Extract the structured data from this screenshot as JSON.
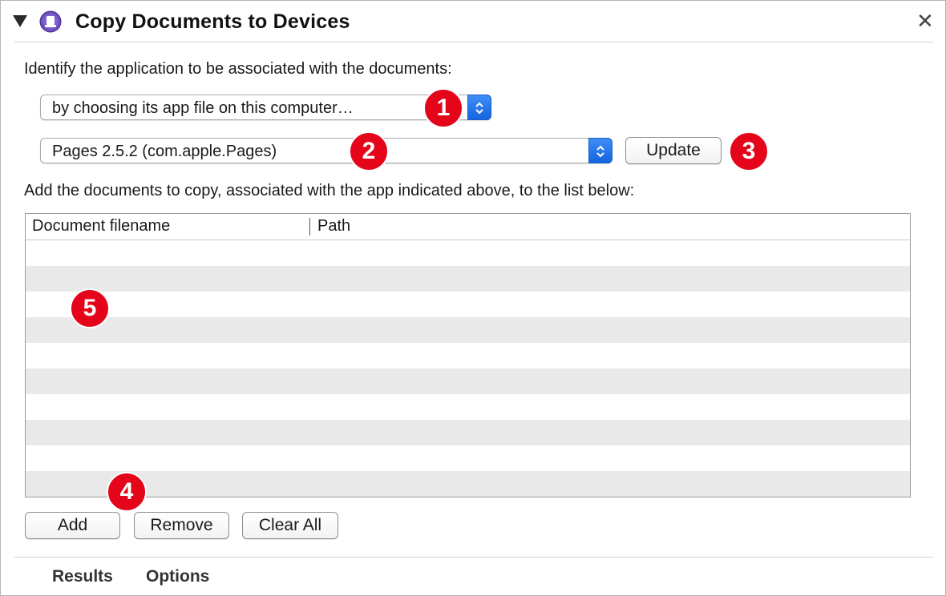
{
  "header": {
    "title": "Copy Documents to Devices",
    "action_icon": "automator-device-icon",
    "close_label": "✕"
  },
  "app_section": {
    "prompt": "Identify the application to be associated with the documents:",
    "method_popup": {
      "selected": "by choosing its app file on this computer…"
    },
    "app_popup": {
      "selected": "Pages 2.5.2 (com.apple.Pages)"
    },
    "update_button": "Update"
  },
  "documents_section": {
    "prompt": "Add the documents to copy, associated with the app indicated above, to the list below:",
    "columns": [
      "Document filename",
      "Path"
    ],
    "rows": []
  },
  "buttons": {
    "add": "Add",
    "remove": "Remove",
    "clear_all": "Clear All"
  },
  "callouts": {
    "c1": "1",
    "c2": "2",
    "c3": "3",
    "c4": "4",
    "c5": "5",
    "color": "#e4051b"
  },
  "footer_tabs": [
    "Results",
    "Options"
  ]
}
